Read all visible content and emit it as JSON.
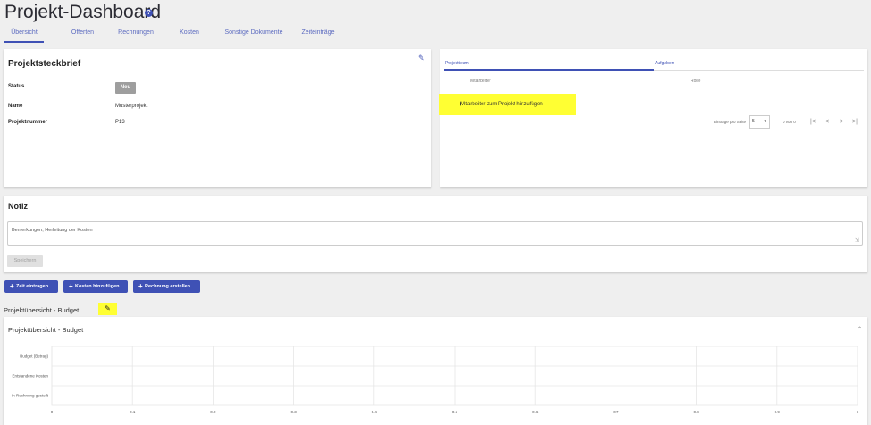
{
  "page_title": "Projekt-Dashboard",
  "help_icon": "question-circle-icon",
  "tabs": [
    {
      "label": "Übersicht",
      "active": true
    },
    {
      "label": "Offerten",
      "active": false
    },
    {
      "label": "Rechnungen",
      "active": false
    },
    {
      "label": "Kosten",
      "active": false
    },
    {
      "label": "Sonstige Dokumente",
      "active": false
    },
    {
      "label": "Zeiteinträge",
      "active": false
    }
  ],
  "steckbrief": {
    "title": "Projektsteckbrief",
    "status_label": "Status",
    "status_value": "Neu",
    "name_label": "Name",
    "name_value": "Musterprojekt",
    "number_label": "Projektnummer",
    "number_value": "P13"
  },
  "team": {
    "tab_team": "Projektteam",
    "tab_tasks": "Aufgaben",
    "col_member": "Mitarbeiter",
    "col_role": "Rolle",
    "add_member": "Mitarbeiter zum Projekt hinzufügen",
    "page_size_label": "Einträge pro Seite",
    "page_size": "5",
    "range": "0 von 0"
  },
  "notiz": {
    "title": "Notiz",
    "placeholder": "Bemerkungen, Herleitung der Kosten",
    "save": "Speichern"
  },
  "actions": {
    "time": "Zeit eintragen",
    "costs": "Kosten hinzufügen",
    "invoice": "Rechnung erstellen"
  },
  "budget": {
    "heading": "Projektübersicht - Budget",
    "panel_title": "Projektübersicht - Budget"
  },
  "chart_data": {
    "type": "bar",
    "orientation": "horizontal",
    "categories": [
      "Budget (Betrag)",
      "Entstandene Kosten",
      "In Rechnung gestellt"
    ],
    "values": [
      0,
      0,
      0
    ],
    "xlim": [
      0,
      1
    ],
    "xticks": [
      "0",
      "0.1",
      "0.2",
      "0.3",
      "0.4",
      "0.5",
      "0.6",
      "0.7",
      "0.8",
      "0.9",
      "1"
    ],
    "grid": true
  }
}
